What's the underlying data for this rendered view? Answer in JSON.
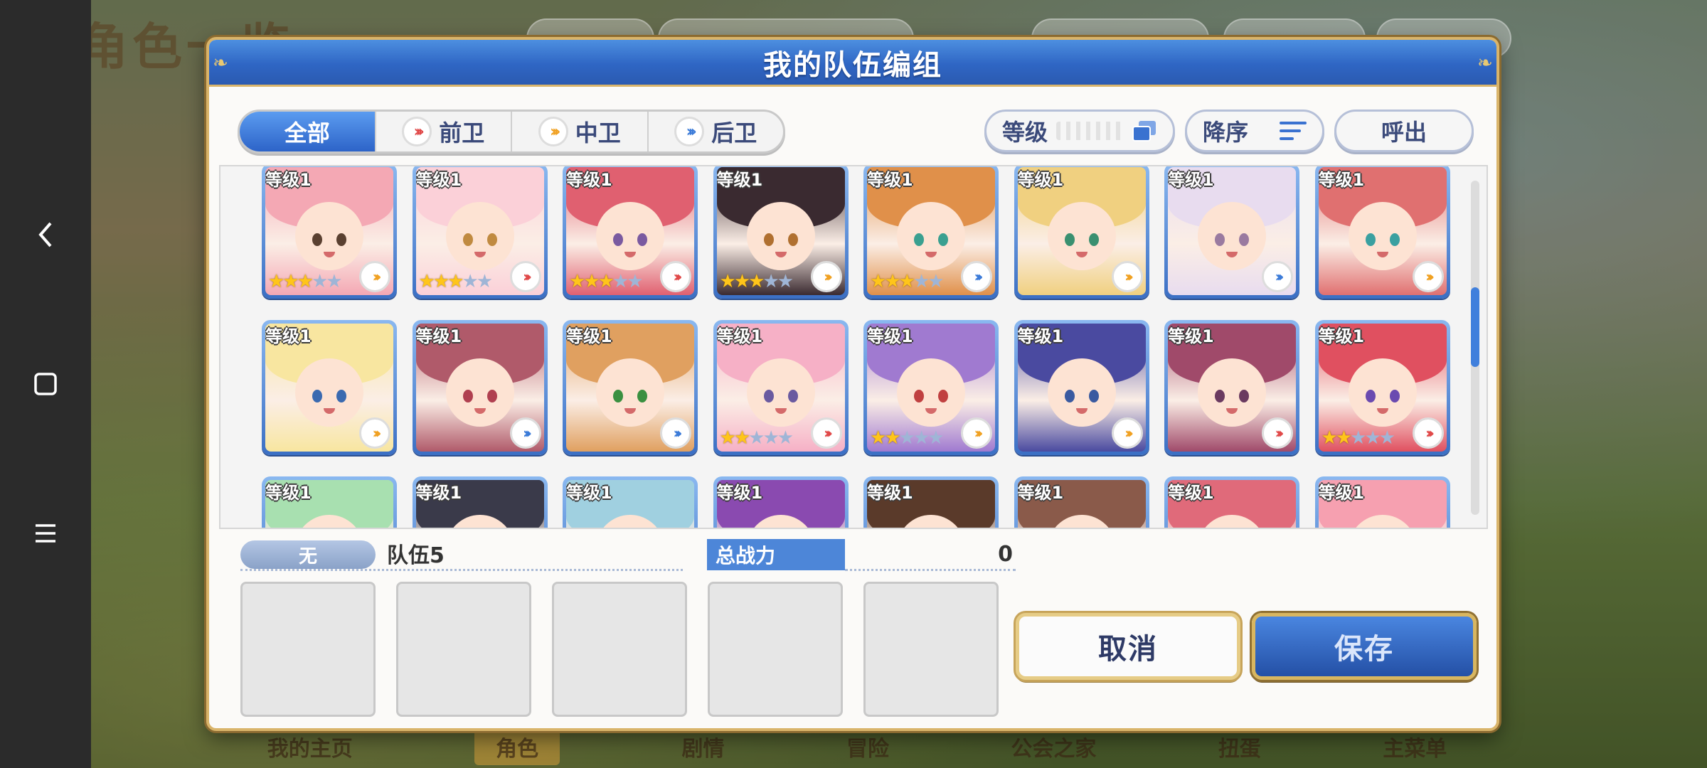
{
  "background": {
    "screen_title": "角色一览",
    "bottom_nav": [
      "我的主页",
      "角色",
      "剧情",
      "冒险",
      "公会之家",
      "扭蛋",
      "主菜单"
    ],
    "bottom_nav_active": 1
  },
  "dialog": {
    "title": "我的队伍编组",
    "tabs": [
      {
        "label": "全部",
        "icon": "",
        "active": true
      },
      {
        "label": "前卫",
        "icon": "red-chevron-icon",
        "active": false
      },
      {
        "label": "中卫",
        "icon": "orange-chevron-icon",
        "active": false
      },
      {
        "label": "后卫",
        "icon": "blue-chevron-icon",
        "active": false
      }
    ],
    "sort_label": "等级",
    "order_label": "降序",
    "recall_label": "呼出",
    "characters": [
      {
        "level": "等级1",
        "stars": 3,
        "role": "orange",
        "hair": "#f4a8b4",
        "eye": "#5a4030"
      },
      {
        "level": "等级1",
        "stars": 3,
        "role": "red",
        "hair": "#fbd0d8",
        "eye": "#c08a40"
      },
      {
        "level": "等级1",
        "stars": 3,
        "role": "red",
        "hair": "#e06070",
        "eye": "#7a5aa0"
      },
      {
        "level": "等级1",
        "stars": 3,
        "role": "orange",
        "hair": "#3a2a30",
        "eye": "#b07030"
      },
      {
        "level": "等级1",
        "stars": 3,
        "role": "blue",
        "hair": "#e0904a",
        "eye": "#3aa090"
      },
      {
        "level": "等级1",
        "stars": 0,
        "role": "orange",
        "hair": "#f0d080",
        "eye": "#3a9070"
      },
      {
        "level": "等级1",
        "stars": 0,
        "role": "blue",
        "hair": "#e8dcef",
        "eye": "#9a7aa0"
      },
      {
        "level": "等级1",
        "stars": 0,
        "role": "orange",
        "hair": "#e07070",
        "eye": "#3aa0a0"
      },
      {
        "level": "等级1",
        "stars": 0,
        "role": "orange",
        "hair": "#f8e6a0",
        "eye": "#3a6ab0"
      },
      {
        "level": "等级1",
        "stars": 0,
        "role": "blue",
        "hair": "#b05a6a",
        "eye": "#b04050"
      },
      {
        "level": "等级1",
        "stars": 0,
        "role": "blue",
        "hair": "#e0a060",
        "eye": "#3a9040"
      },
      {
        "level": "等级1",
        "stars": 2,
        "role": "red",
        "hair": "#f6b0c6",
        "eye": "#6a5aa0"
      },
      {
        "level": "等级1",
        "stars": 2,
        "role": "orange",
        "hair": "#a07ad0",
        "eye": "#c04040"
      },
      {
        "level": "等级1",
        "stars": 0,
        "role": "orange",
        "hair": "#4a4aa0",
        "eye": "#3a5aa0"
      },
      {
        "level": "等级1",
        "stars": 0,
        "role": "red",
        "hair": "#a04a6a",
        "eye": "#6a3a60"
      },
      {
        "level": "等级1",
        "stars": 2,
        "role": "red",
        "hair": "#e05060",
        "eye": "#6a4ab0"
      },
      {
        "level": "等级1",
        "stars": 0,
        "role": "orange",
        "hair": "#a8e0b0",
        "eye": "#3a8060"
      },
      {
        "level": "等级1",
        "stars": 0,
        "role": "blue",
        "hair": "#3a3a4a",
        "eye": "#5a5a8a"
      },
      {
        "level": "等级1",
        "stars": 0,
        "role": "blue",
        "hair": "#a0d0e0",
        "eye": "#3a6a9a"
      },
      {
        "level": "等级1",
        "stars": 0,
        "role": "red",
        "hair": "#8a4ab0",
        "eye": "#6a3a9a"
      },
      {
        "level": "等级1",
        "stars": 0,
        "role": "orange",
        "hair": "#5a3a2a",
        "eye": "#6a4a3a"
      },
      {
        "level": "等级1",
        "stars": 0,
        "role": "orange",
        "hair": "#8a5a4a",
        "eye": "#6a4a3a"
      },
      {
        "level": "等级1",
        "stars": 0,
        "role": "red",
        "hair": "#e06a7a",
        "eye": "#8a3a4a"
      },
      {
        "level": "等级1",
        "stars": 0,
        "role": "blue",
        "hair": "#f6a0b0",
        "eye": "#8a4a5a"
      }
    ],
    "scroll_position": 0.42,
    "team": {
      "badge": "无",
      "name": "队伍5",
      "power_label": "总战力",
      "power_value": "0",
      "slots": 5
    },
    "cancel_label": "取消",
    "save_label": "保存"
  }
}
